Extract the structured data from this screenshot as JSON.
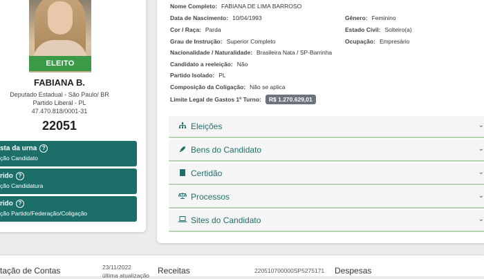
{
  "candidate": {
    "elected_label": "ELEITO",
    "name": "FABIANA B.",
    "office": "Deputado Estadual - São Paulo/ BR",
    "party": "Partido Liberal - PL",
    "cnpj": "47.470.818/0001-31",
    "number": "22051"
  },
  "action_buttons": [
    {
      "title": "sta da urna",
      "subtitle": "ção Candidato"
    },
    {
      "title": "rido",
      "subtitle": "ção Candidatura"
    },
    {
      "title": "rido",
      "subtitle": "ção Partido/Federação/Coligação"
    }
  ],
  "details": {
    "nome_completo": {
      "label": "Nome Completo:",
      "value": "FABIANA DE LIMA BARROSO"
    },
    "data_nascimento": {
      "label": "Data de Nascimento:",
      "value": "10/04/1993"
    },
    "genero": {
      "label": "Gênero:",
      "value": "Feminino"
    },
    "cor_raca": {
      "label": "Cor / Raça:",
      "value": "Parda"
    },
    "estado_civil": {
      "label": "Estado Civil:",
      "value": "Solteiro(a)"
    },
    "grau_instrucao": {
      "label": "Grau de Instrução:",
      "value": "Superior Completo"
    },
    "ocupacao": {
      "label": "Ocupação:",
      "value": "Empresário"
    },
    "nacionalidade": {
      "label": "Nacionalidade / Naturalidade:",
      "value": "Brasileira Nata / SP-Barrinha"
    },
    "reeleicao": {
      "label": "Candidato a reeleição:",
      "value": "Não"
    },
    "partido_isolado": {
      "label": "Partido Isolado:",
      "value": "PL"
    },
    "composicao": {
      "label": "Composição da Coligação:",
      "value": "Não se aplica"
    },
    "limite": {
      "label": "Limite Legal de Gastos 1º Turno:",
      "value": "R$ 1.270.629,01"
    }
  },
  "accordions": [
    {
      "label": "Eleições",
      "icon": "sitemap-icon"
    },
    {
      "label": "Bens do Candidato",
      "icon": "rocket-icon"
    },
    {
      "label": "Certidão",
      "icon": "document-icon"
    },
    {
      "label": "Processos",
      "icon": "scales-icon"
    },
    {
      "label": "Sites do Candidato",
      "icon": "laptop-icon"
    }
  ],
  "bottom": {
    "contas_label": "tação de Contas",
    "date": "23/11/2022",
    "update_label": "última atualização",
    "receitas_label": "Receitas",
    "receipt_code": "220510700000SP5275171",
    "despesas_label": "Despesas"
  },
  "colors": {
    "accent_teal": "#1c6f69",
    "elected_green": "#3b9a46",
    "badge_gray": "#6b747d"
  }
}
